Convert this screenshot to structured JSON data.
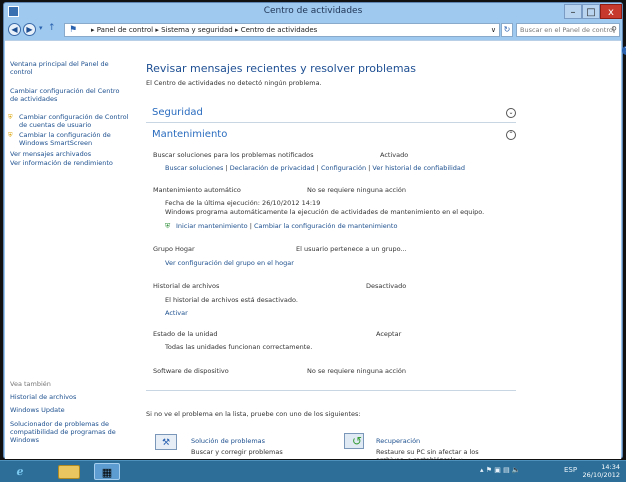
{
  "window": {
    "title": "Centro de actividades",
    "minimize": "–",
    "maximize": "□",
    "close": "x"
  },
  "address": {
    "crumb_root": "Panel de control",
    "crumb_mid": "Sistema y seguridad",
    "crumb_current": "Centro de actividades",
    "sep": "▸",
    "dropdown": "∨",
    "refresh": "↻",
    "search_placeholder": "Buscar en el Panel de control",
    "search_icon": "search-icon"
  },
  "sidebar": {
    "home": "Ventana principal del Panel de control",
    "items": [
      {
        "label": "Cambiar configuración del Centro de actividades",
        "shield": false
      },
      {
        "label": "Cambiar configuración de Control de cuentas de usuario",
        "shield": true
      },
      {
        "label": "Cambiar la configuración de Windows SmartScreen",
        "shield": true
      },
      {
        "label": "Ver mensajes archivados",
        "shield": false
      },
      {
        "label": "Ver información de rendimiento",
        "shield": false
      }
    ],
    "see_also": "Vea también",
    "see_also_items": [
      "Historial de archivos",
      "Windows Update",
      "Solucionador de problemas de compatibilidad de programas de Windows"
    ]
  },
  "main": {
    "heading": "Revisar mensajes recientes y resolver problemas",
    "subheading": "El Centro de actividades no detectó ningún problema.",
    "security": "Seguridad",
    "maintenance": "Mantenimiento",
    "problems": {
      "label": "Buscar soluciones para los problemas notificados",
      "status": "Activado",
      "links": [
        "Buscar soluciones",
        "Declaración de privacidad",
        "Configuración",
        "Ver historial de confiabilidad"
      ],
      "sep": "|"
    },
    "auto": {
      "label": "Mantenimiento automático",
      "status": "No se requiere ninguna acción",
      "date": "Fecha de la última ejecución: 26/10/2012 14:19",
      "desc": "Windows programa automáticamente la ejecución de actividades de mantenimiento en el equipo.",
      "link1": "Iniciar mantenimiento",
      "link2": "Cambiar la configuración de mantenimiento"
    },
    "homegroup": {
      "label": "Grupo Hogar",
      "status": "El usuario pertenece a un grupo...",
      "link": "Ver configuración del grupo en el hogar"
    },
    "filehistory": {
      "label": "Historial de archivos",
      "status": "Desactivado",
      "desc": "El historial de archivos está desactivado.",
      "link": "Activar"
    },
    "drive": {
      "label": "Estado de la unidad",
      "status": "Aceptar",
      "desc": "Todas las unidades funcionan correctamente."
    },
    "device": {
      "label": "Software de dispositivo",
      "status": "No se requiere ninguna acción"
    },
    "footer": "Si no ve el problema en la lista, pruebe con uno de los siguientes:",
    "troubleshoot": {
      "title": "Solución de problemas",
      "desc": "Buscar y corregir problemas"
    },
    "recovery": {
      "title": "Recuperación",
      "desc": "Restaure su PC sin afectar a los",
      "desc2": "archivos, o restablézcalo y..."
    }
  },
  "taskbar": {
    "lang": "ESP",
    "time": "14:34",
    "date": "26/10/2012",
    "tray": "▴  ⚑  ▣  ▤  🔈"
  },
  "colors": {
    "link": "#1c4f8e",
    "heading": "#1e4f93",
    "section": "#2a6cbf",
    "taskbar": "#2c6e98",
    "close": "#c7392c"
  }
}
